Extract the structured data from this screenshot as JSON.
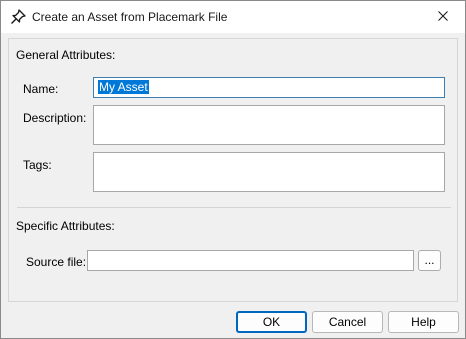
{
  "window": {
    "title": "Create an Asset from Placemark File",
    "icon": "placemark-pin-icon",
    "close_icon": "close-icon"
  },
  "general": {
    "section_title": "General Attributes:",
    "name_label": "Name:",
    "name_value": "My Asset",
    "description_label": "Description:",
    "description_value": "",
    "tags_label": "Tags:",
    "tags_value": ""
  },
  "specific": {
    "section_title": "Specific Attributes:",
    "source_label": "Source file:",
    "source_value": "",
    "browse_label": "..."
  },
  "buttons": {
    "ok": "OK",
    "cancel": "Cancel",
    "help": "Help"
  },
  "colors": {
    "selection": "#0078d7",
    "focus_border": "#3c7fb1",
    "default_button_border": "#0067c0"
  }
}
